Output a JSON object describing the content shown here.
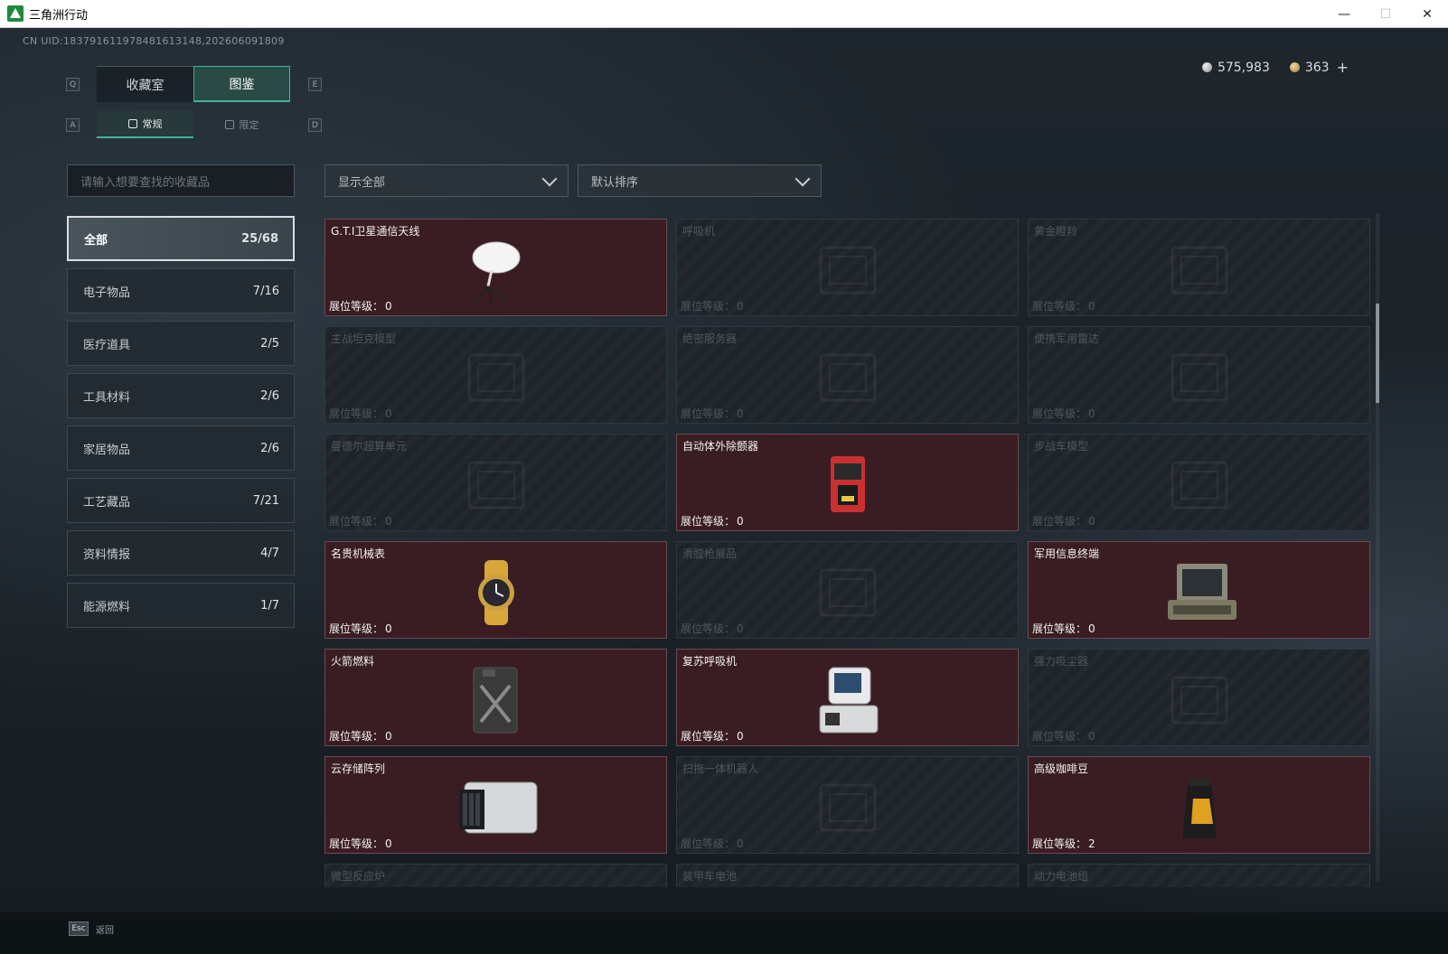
{
  "window": {
    "title": "三角洲行动",
    "minimize": "—",
    "maximize": "☐",
    "close": "✕"
  },
  "uid": "CN UID:18379161197848161314​8,202606091809",
  "currency": [
    {
      "icon": "silver-coin-icon",
      "value": "575,983"
    },
    {
      "icon": "gold-coin-icon",
      "value": "363"
    }
  ],
  "currency_plus": "+",
  "keys": {
    "q": "Q",
    "e": "E",
    "a": "A",
    "d": "D",
    "esc": "Esc"
  },
  "tabs": [
    {
      "label": "收藏室",
      "active": false
    },
    {
      "label": "图鉴",
      "active": true
    }
  ],
  "subtabs": [
    {
      "label": "常规",
      "active": true
    },
    {
      "label": "限定",
      "active": false
    }
  ],
  "search": {
    "placeholder": "请输入想要查找的收藏品"
  },
  "filters": {
    "show": "显示全部",
    "sort": "默认排序"
  },
  "categories": [
    {
      "label": "全部",
      "count": "25/68",
      "active": true
    },
    {
      "label": "电子物品",
      "count": "7/16",
      "active": false
    },
    {
      "label": "医疗道具",
      "count": "2/5",
      "active": false
    },
    {
      "label": "工具材料",
      "count": "2/6",
      "active": false
    },
    {
      "label": "家居物品",
      "count": "2/6",
      "active": false
    },
    {
      "label": "工艺藏品",
      "count": "7/21",
      "active": false
    },
    {
      "label": "资料情报",
      "count": "4/7",
      "active": false
    },
    {
      "label": "能源燃料",
      "count": "1/7",
      "active": false
    }
  ],
  "level_label": "展位等级：",
  "items": [
    {
      "name": "G.T.I卫星通信天线",
      "level": "0",
      "owned": true,
      "icon": "satellite-dish-icon"
    },
    {
      "name": "呼吸机",
      "level": "0",
      "owned": false,
      "icon": "ventilator-icon"
    },
    {
      "name": "黄金瞪羚",
      "level": "0",
      "owned": false,
      "icon": "gazelle-statue-icon"
    },
    {
      "name": "主战坦克模型",
      "level": "0",
      "owned": false,
      "icon": "tank-model-icon"
    },
    {
      "name": "绝密服务器",
      "level": "0",
      "owned": false,
      "icon": "server-icon"
    },
    {
      "name": "便携军用雷达",
      "level": "0",
      "owned": false,
      "icon": "radar-icon"
    },
    {
      "name": "曼德尔超算单元",
      "level": "0",
      "owned": false,
      "icon": "compute-unit-icon"
    },
    {
      "name": "自动体外除颤器",
      "level": "0",
      "owned": true,
      "icon": "defibrillator-icon"
    },
    {
      "name": "步战车模型",
      "level": "0",
      "owned": false,
      "icon": "ifv-model-icon"
    },
    {
      "name": "名贵机械表",
      "level": "0",
      "owned": true,
      "icon": "wristwatch-icon"
    },
    {
      "name": "滑膛枪展品",
      "level": "0",
      "owned": false,
      "icon": "musket-icon"
    },
    {
      "name": "军用信息终端",
      "level": "0",
      "owned": true,
      "icon": "military-terminal-icon"
    },
    {
      "name": "火箭燃料",
      "level": "0",
      "owned": true,
      "icon": "fuel-canister-icon"
    },
    {
      "name": "复苏呼吸机",
      "level": "0",
      "owned": true,
      "icon": "resuscitator-icon"
    },
    {
      "name": "强力吸尘器",
      "level": "0",
      "owned": false,
      "icon": "vacuum-icon"
    },
    {
      "name": "云存储阵列",
      "level": "0",
      "owned": true,
      "icon": "storage-array-icon"
    },
    {
      "name": "扫拖一体机器人",
      "level": "0",
      "owned": false,
      "icon": "robot-vacuum-icon"
    },
    {
      "name": "高级咖啡豆",
      "level": "2",
      "owned": true,
      "icon": "coffee-bag-icon"
    },
    {
      "name": "微型反应炉",
      "level": "",
      "owned": false,
      "icon": "reactor-icon"
    },
    {
      "name": "装甲车电池",
      "level": "",
      "owned": false,
      "icon": "battery-icon"
    },
    {
      "name": "动力电池组",
      "level": "",
      "owned": false,
      "icon": "battery-pack-icon"
    }
  ],
  "back_label": "返回"
}
